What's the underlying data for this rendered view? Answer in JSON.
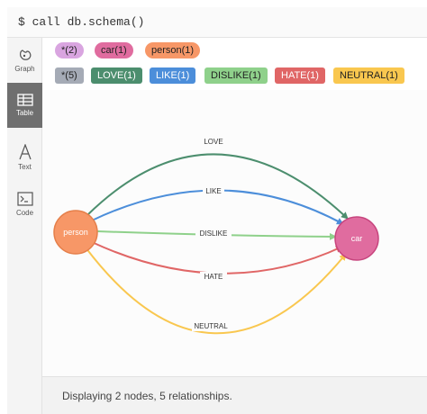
{
  "command": "$ call db.schema()",
  "sidebar": {
    "items": [
      {
        "label": "Graph",
        "icon": "graph-icon",
        "active": false
      },
      {
        "label": "Table",
        "icon": "table-icon",
        "active": true
      },
      {
        "label": "Text",
        "icon": "text-icon",
        "active": false
      },
      {
        "label": "Code",
        "icon": "code-icon",
        "active": false
      }
    ]
  },
  "node_labels": [
    {
      "text": "*(2)",
      "color": "#d9a5e0"
    },
    {
      "text": "car(1)",
      "color": "#e06c9f"
    },
    {
      "text": "person(1)",
      "color": "#f79767"
    }
  ],
  "rel_types": [
    {
      "text": "*(5)",
      "color": "#a5abb6"
    },
    {
      "text": "LOVE(1)",
      "color": "#4c8e6e"
    },
    {
      "text": "LIKE(1)",
      "color": "#4c8eda"
    },
    {
      "text": "DISLIKE(1)",
      "color": "#8fd18b"
    },
    {
      "text": "HATE(1)",
      "color": "#e06666"
    },
    {
      "text": "NEUTRAL(1)",
      "color": "#f9c74f"
    }
  ],
  "graph": {
    "nodes": {
      "person": {
        "label": "person",
        "color": "#f79767",
        "stroke": "#e57f4a"
      },
      "car": {
        "label": "car",
        "color": "#e06c9f",
        "stroke": "#c7457e"
      }
    },
    "edges": [
      {
        "label": "LOVE",
        "color": "#4c8e6e"
      },
      {
        "label": "LIKE",
        "color": "#4c8eda"
      },
      {
        "label": "DISLIKE",
        "color": "#8fd18b"
      },
      {
        "label": "HATE",
        "color": "#e06666"
      },
      {
        "label": "NEUTRAL",
        "color": "#f9c74f"
      }
    ]
  },
  "status_text": "Displaying 2 nodes, 5 relationships."
}
